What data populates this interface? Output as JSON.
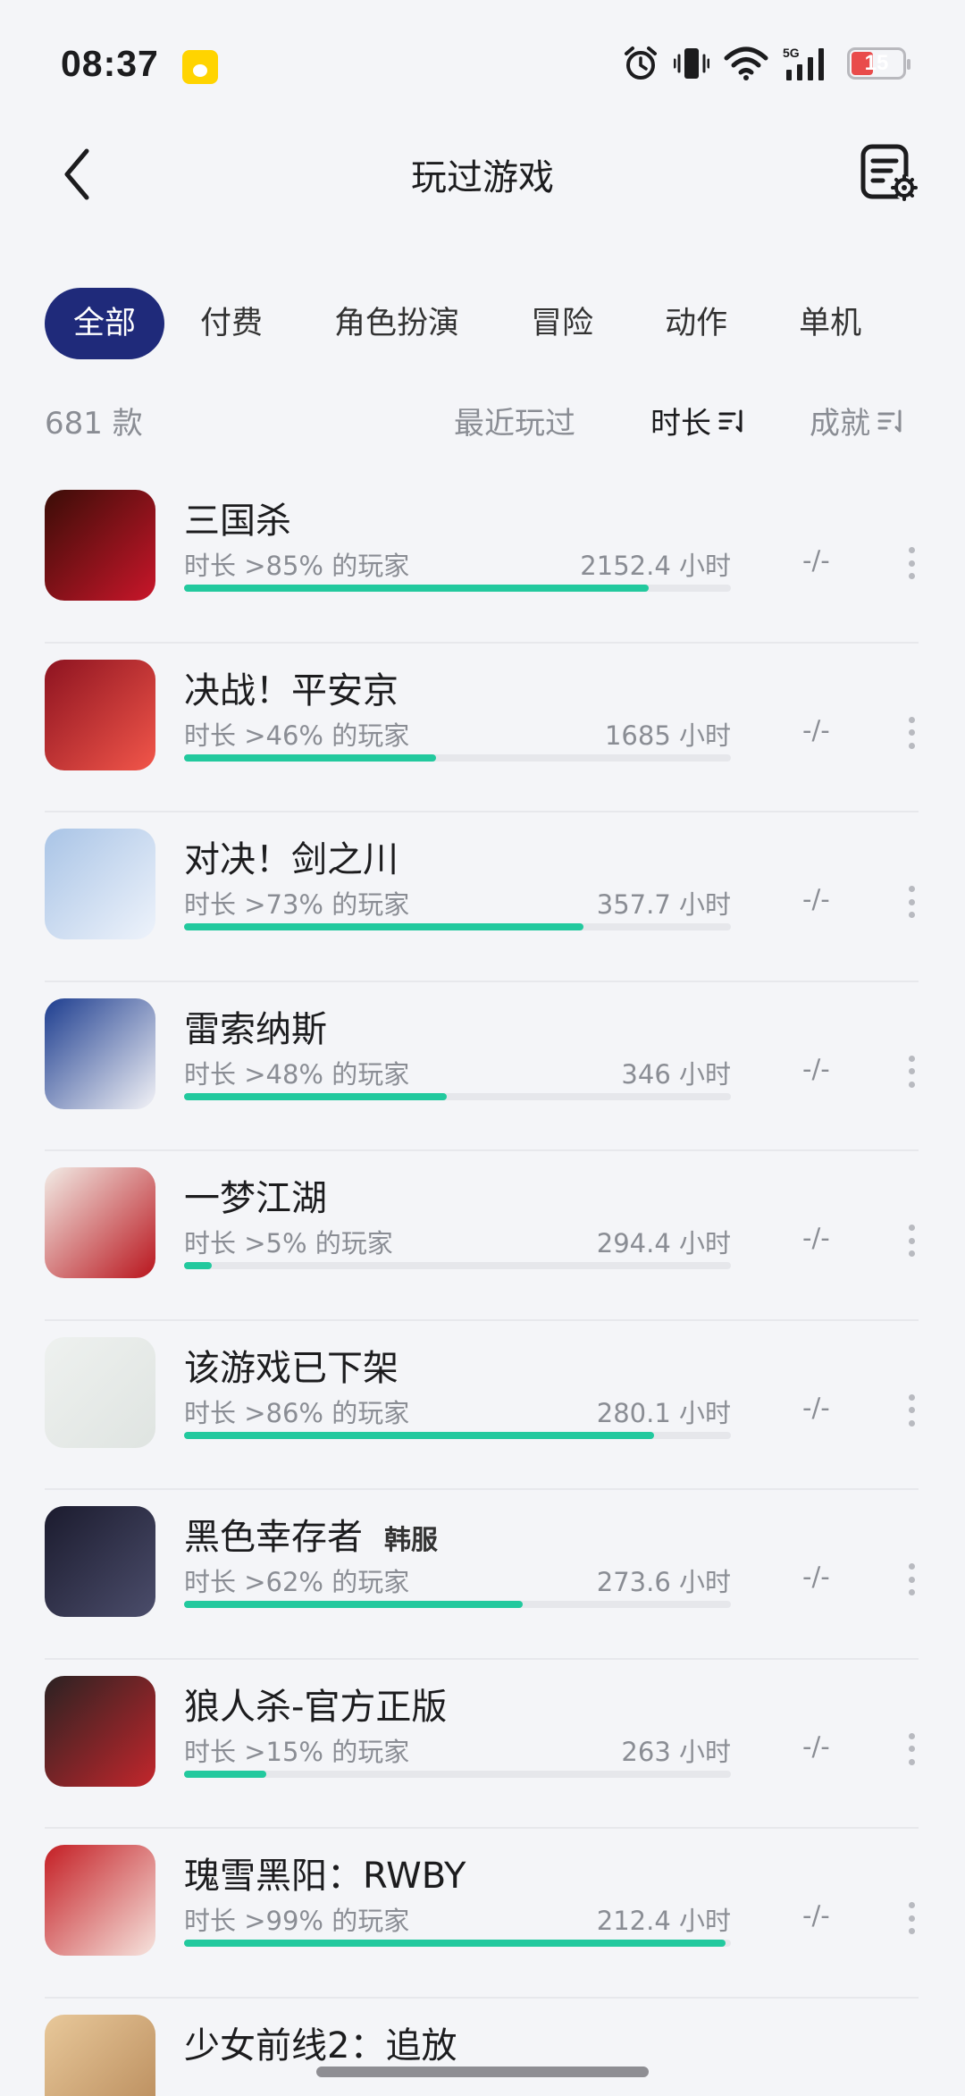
{
  "status_bar": {
    "time": "08:37",
    "battery": "15",
    "network": "5G"
  },
  "header": {
    "title": "玩过游戏"
  },
  "tabs": [
    {
      "label": "全部"
    },
    {
      "label": "付费"
    },
    {
      "label": "角色扮演"
    },
    {
      "label": "冒险"
    },
    {
      "label": "动作"
    },
    {
      "label": "单机"
    }
  ],
  "sort": {
    "count": "681 款",
    "recent": "最近玩过",
    "duration": "时长",
    "achievement": "成就"
  },
  "games": [
    {
      "name": "三国杀",
      "tag": "",
      "percentile": "时长 >85% 的玩家",
      "hours": "2152.4 小时",
      "progress": 0.85,
      "achievement": "-/-",
      "icon_colors": [
        "#3a0d07",
        "#c9162a"
      ]
    },
    {
      "name": "决战！平安京",
      "tag": "",
      "percentile": "时长 >46% 的玩家",
      "hours": "1685 小时",
      "progress": 0.46,
      "achievement": "-/-",
      "icon_colors": [
        "#8d1320",
        "#f2564a"
      ]
    },
    {
      "name": "对决！剑之川",
      "tag": "",
      "percentile": "时长 >73% 的玩家",
      "hours": "357.7 小时",
      "progress": 0.73,
      "achievement": "-/-",
      "icon_colors": [
        "#a9c4e6",
        "#eef3fb"
      ]
    },
    {
      "name": "雷索纳斯",
      "tag": "",
      "percentile": "时长 >48% 的玩家",
      "hours": "346 小时",
      "progress": 0.48,
      "achievement": "-/-",
      "icon_colors": [
        "#1d3d8f",
        "#f3f3f7"
      ]
    },
    {
      "name": "一梦江湖",
      "tag": "",
      "percentile": "时长 >5% 的玩家",
      "hours": "294.4 小时",
      "progress": 0.05,
      "achievement": "-/-",
      "icon_colors": [
        "#f2ece6",
        "#b9151d"
      ]
    },
    {
      "name": "该游戏已下架",
      "tag": "",
      "percentile": "时长 >86% 的玩家",
      "hours": "280.1 小时",
      "progress": 0.86,
      "achievement": "-/-",
      "icon_colors": [
        "#eef1ef",
        "#dfe4e1"
      ]
    },
    {
      "name": "黑色幸存者",
      "tag": "韩服",
      "percentile": "时长 >62% 的玩家",
      "hours": "273.6 小时",
      "progress": 0.62,
      "achievement": "-/-",
      "icon_colors": [
        "#1b1b2e",
        "#4b4d6b"
      ]
    },
    {
      "name": "狼人杀-官方正版",
      "tag": "",
      "percentile": "时长 >15% 的玩家",
      "hours": "263 小时",
      "progress": 0.15,
      "achievement": "-/-",
      "icon_colors": [
        "#2a2222",
        "#c3262c"
      ]
    },
    {
      "name": "瑰雪黑阳：RWBY",
      "tag": "",
      "percentile": "时长 >99% 的玩家",
      "hours": "212.4 小时",
      "progress": 0.99,
      "achievement": "-/-",
      "icon_colors": [
        "#c41e24",
        "#f6e4de"
      ]
    },
    {
      "name": "少女前线2：追放",
      "tag": "",
      "percentile": "",
      "hours": "",
      "progress": 0,
      "achievement": "",
      "icon_colors": [
        "#e8c89a",
        "#b88a5a"
      ]
    }
  ],
  "colors": {
    "accent": "#1f2a7a",
    "progress": "#22c99e",
    "track": "#e6e7eb"
  },
  "icons": {
    "back": "back-arrow-icon",
    "settings": "list-settings-icon",
    "sort": "sort-icon",
    "more": "more-vertical-icon"
  }
}
